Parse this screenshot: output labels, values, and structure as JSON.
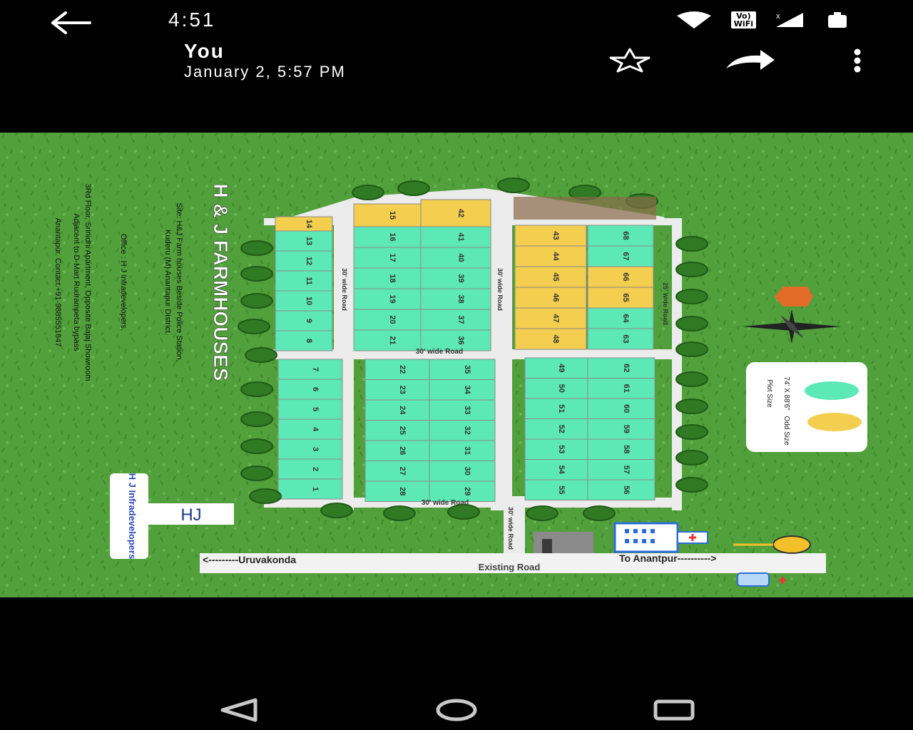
{
  "status_bar": {
    "time": "4:51",
    "volte_line1": "Vo)",
    "volte_line2": "WiFi",
    "icons": [
      "wifi-icon",
      "volte-icon",
      "signal-icon",
      "battery-icon"
    ]
  },
  "app_bar": {
    "sender": "You",
    "datetime": "January 2, 5:57 PM",
    "actions": [
      "back-arrow-icon",
      "star-icon",
      "share-icon",
      "more-vert-icon"
    ]
  },
  "layout_image": {
    "title": "H & J FARMHOUSES",
    "site_line1": "Site: H&J Farm houses Beside Police Station,",
    "site_line2": "Kuderu (M) Anantapur District.",
    "office_line1": "Office : H J Infradevelopers,",
    "office_line2": "3Rd Floor, Srinidhi Apartment, Opposite Bajaj Showroom",
    "office_line3": "Adjacent to D-Mart Rudrampeta bypass",
    "office_line4": "Anantapur. Contact:+91-9885551647",
    "brand_logo": "HJ",
    "brand_name": "H J Infradevelopers",
    "roads": {
      "road_30_wide_a": "30' wide Road",
      "road_30_wide_b": "30' wide Road",
      "road_30_wide_c": "30' wide Road",
      "road_30_wide_top": "30' wide Road",
      "road_30_wide_mid": "30' wide Road",
      "road_25_wide": "25' wide Road",
      "existing_road": "Existing Road",
      "to_left": "<---------Uruvakonda",
      "to_right": "To Anantpur---------->"
    },
    "legend": {
      "plot_size_value": "74' X 88'6\"",
      "plot_size_label": "Plot Size",
      "odd_size_label": "Odd Size",
      "plot_color": "#5de8b8",
      "odd_color": "#f4cf4f"
    },
    "colors": {
      "grass": "#4e9a3a",
      "road": "#e8e8e8",
      "plot": "#5de8b8",
      "odd_plot": "#f4cf4f"
    },
    "block_a_yellow": [
      "14"
    ],
    "block_a_top": [
      "13",
      "12",
      "11",
      "10",
      "9",
      "8"
    ],
    "block_a_bottom": [
      "7",
      "6",
      "5",
      "4",
      "3",
      "2",
      "1"
    ],
    "block_b_yellow": [
      "15"
    ],
    "block_b_top": [
      "16",
      "17",
      "18",
      "19",
      "20",
      "21"
    ],
    "block_b_bottom": [
      "22",
      "23",
      "24",
      "25",
      "26",
      "27",
      "28"
    ],
    "block_c_yellow": [
      "42"
    ],
    "block_c_top": [
      "41",
      "40",
      "39",
      "38",
      "37",
      "36"
    ],
    "block_c_bottom": [
      "35",
      "34",
      "33",
      "32",
      "31",
      "30",
      "29"
    ],
    "block_d_top": [
      "43",
      "44",
      "45",
      "46",
      "47",
      "48"
    ],
    "block_d_bottom": [
      "49",
      "50",
      "51",
      "52",
      "53",
      "54",
      "55"
    ],
    "block_e_top": [
      "68",
      "67",
      "66",
      "65",
      "64",
      "63"
    ],
    "block_e_top_colors": [
      "plot",
      "plot",
      "odd",
      "odd",
      "plot",
      "plot"
    ],
    "block_e_bottom": [
      "62",
      "61",
      "60",
      "59",
      "58",
      "57",
      "56"
    ]
  },
  "nav_bar": {
    "buttons": [
      "back-triangle-icon",
      "home-circle-icon",
      "recents-square-icon"
    ]
  }
}
